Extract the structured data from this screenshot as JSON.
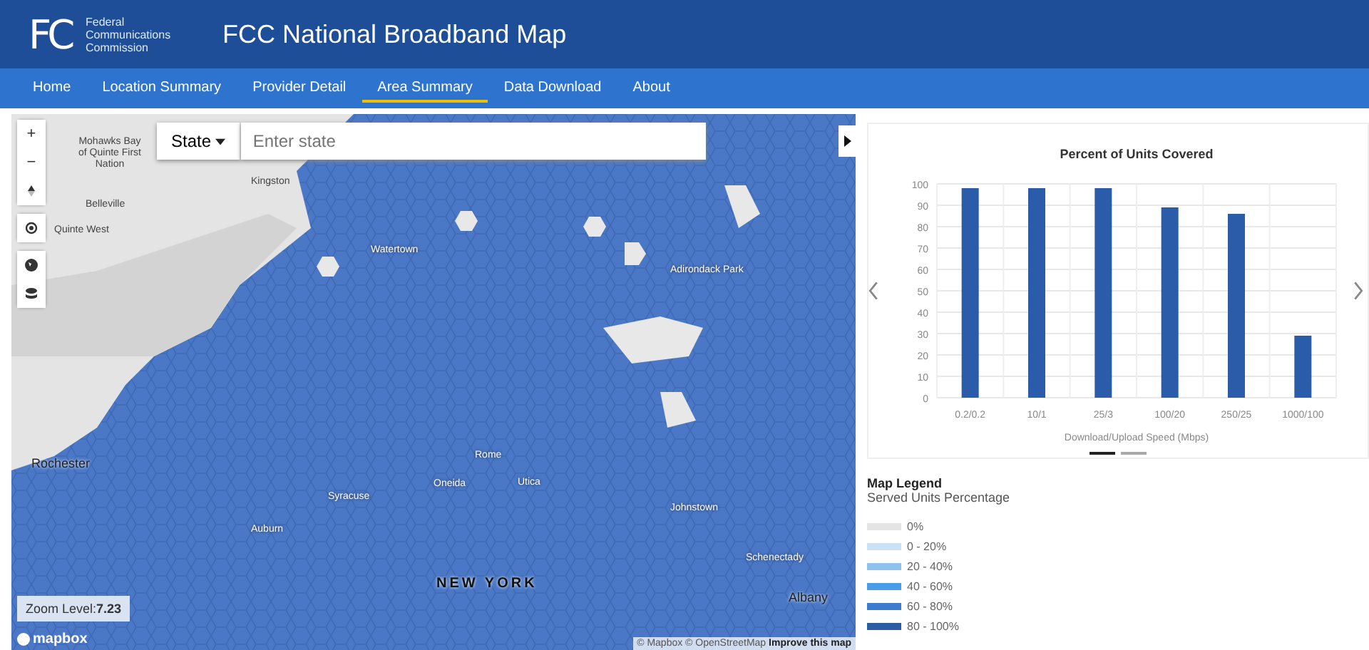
{
  "header": {
    "agency_lines": [
      "Federal",
      "Communications",
      "Commission"
    ],
    "logo_text": "FC",
    "title": "FCC National Broadband Map"
  },
  "nav": [
    {
      "label": "Home",
      "selected": false
    },
    {
      "label": "Location Summary",
      "selected": false
    },
    {
      "label": "Provider Detail",
      "selected": false
    },
    {
      "label": "Area Summary",
      "selected": true
    },
    {
      "label": "Data Download",
      "selected": false
    },
    {
      "label": "About",
      "selected": false
    }
  ],
  "map": {
    "controls": [
      "+",
      "−"
    ],
    "search": {
      "dropdown": "State",
      "placeholder": "Enter state"
    },
    "labels": [
      {
        "text": "Mohawks Bay of Quinte First Nation",
        "kind": "land"
      },
      {
        "text": "Kingston",
        "kind": "land"
      },
      {
        "text": "Belleville",
        "kind": "land"
      },
      {
        "text": "Quinte West",
        "kind": "land"
      },
      {
        "text": "Watertown",
        "kind": "town"
      },
      {
        "text": "Adirondack Park",
        "kind": "town"
      },
      {
        "text": "Rochester",
        "kind": "city"
      },
      {
        "text": "Syracuse",
        "kind": "town"
      },
      {
        "text": "Oneida",
        "kind": "town"
      },
      {
        "text": "Utica",
        "kind": "town"
      },
      {
        "text": "Rome",
        "kind": "town"
      },
      {
        "text": "Auburn",
        "kind": "town"
      },
      {
        "text": "Johnstown",
        "kind": "town"
      },
      {
        "text": "Schenectady",
        "kind": "town"
      },
      {
        "text": "NEW YORK",
        "kind": "state"
      },
      {
        "text": "Albany",
        "kind": "city"
      }
    ],
    "zoom_label": "Zoom Level:",
    "zoom_value": "7.23",
    "brand": "mapbox",
    "attribution": "© Mapbox © OpenStreetMap",
    "attribution_link": "Improve this map"
  },
  "chart": {
    "chart_data": {
      "type": "bar",
      "title": "Percent of Units Covered",
      "xlabel": "Download/Upload Speed (Mbps)",
      "categories": [
        "0.2/0.2",
        "10/1",
        "25/3",
        "100/20",
        "250/25",
        "1000/100"
      ],
      "values": [
        98,
        98,
        98,
        89,
        86,
        29
      ],
      "ylim": [
        0,
        100
      ],
      "grid": true,
      "yticks": [
        0,
        10,
        20,
        30,
        40,
        50,
        60,
        70,
        80,
        90,
        100
      ]
    },
    "pager": [
      {
        "selected": true
      },
      {
        "selected": false
      }
    ]
  },
  "legend": {
    "title": "Map Legend",
    "subtitle": "Served Units Percentage",
    "items": [
      {
        "label": "0%",
        "color": "#e4e4e4"
      },
      {
        "label": "0 - 20%",
        "color": "#cce0f6"
      },
      {
        "label": "20 - 40%",
        "color": "#8fc1ee"
      },
      {
        "label": "40 - 60%",
        "color": "#4a9de8"
      },
      {
        "label": "60 - 80%",
        "color": "#3b7ccc"
      },
      {
        "label": "80 - 100%",
        "color": "#2c5ca6"
      }
    ]
  }
}
